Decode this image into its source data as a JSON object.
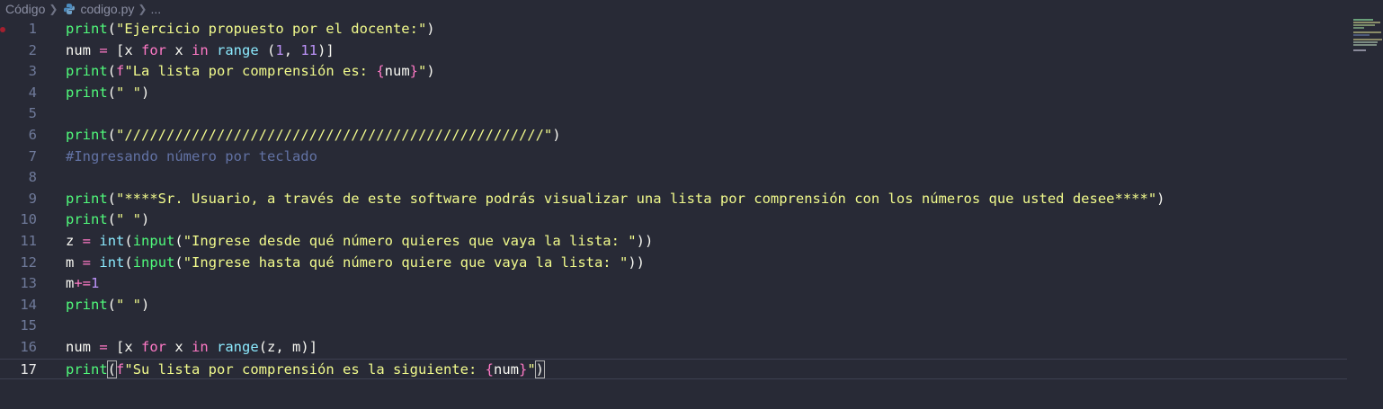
{
  "breadcrumb": {
    "folder": "Código",
    "file": "codigo.py",
    "more": "..."
  },
  "editor": {
    "lines": [
      {
        "n": "1",
        "tokens": [
          [
            "fn",
            "print"
          ],
          [
            "br",
            "("
          ],
          [
            "str",
            "\"Ejercicio propuesto por el docente:\""
          ],
          [
            "br",
            ")"
          ]
        ]
      },
      {
        "n": "2",
        "tokens": [
          [
            "",
            "num "
          ],
          [
            "kw",
            "="
          ],
          [
            "",
            " [x "
          ],
          [
            "kw",
            "for"
          ],
          [
            "",
            " x "
          ],
          [
            "kw",
            "in"
          ],
          [
            "",
            " "
          ],
          [
            "bi",
            "range"
          ],
          [
            "",
            " "
          ],
          [
            "br",
            "("
          ],
          [
            "nm",
            "1"
          ],
          [
            "",
            ", "
          ],
          [
            "nm",
            "11"
          ],
          [
            "br",
            ")"
          ],
          [
            "",
            "]"
          ]
        ]
      },
      {
        "n": "3",
        "tokens": [
          [
            "fn",
            "print"
          ],
          [
            "br",
            "("
          ],
          [
            "kw",
            "f"
          ],
          [
            "str",
            "\"La lista por comprensión es: "
          ],
          [
            "kw",
            "{"
          ],
          [
            "",
            "num"
          ],
          [
            "kw",
            "}"
          ],
          [
            "str",
            "\""
          ],
          [
            "br",
            ")"
          ]
        ]
      },
      {
        "n": "4",
        "tokens": [
          [
            "fn",
            "print"
          ],
          [
            "br",
            "("
          ],
          [
            "str",
            "\" \""
          ],
          [
            "br",
            ")"
          ]
        ]
      },
      {
        "n": "5",
        "tokens": []
      },
      {
        "n": "6",
        "tokens": [
          [
            "fn",
            "print"
          ],
          [
            "br",
            "("
          ],
          [
            "str",
            "\"//////////////////////////////////////////////////\""
          ],
          [
            "br",
            ")"
          ]
        ]
      },
      {
        "n": "7",
        "tokens": [
          [
            "cm",
            "#Ingresando número por teclado"
          ]
        ]
      },
      {
        "n": "8",
        "tokens": []
      },
      {
        "n": "9",
        "tokens": [
          [
            "fn",
            "print"
          ],
          [
            "br",
            "("
          ],
          [
            "str",
            "\"****Sr. Usuario, a través de este software podrás visualizar una lista por comprensión con los números que usted desee****\""
          ],
          [
            "br",
            ")"
          ]
        ]
      },
      {
        "n": "10",
        "tokens": [
          [
            "fn",
            "print"
          ],
          [
            "br",
            "("
          ],
          [
            "str",
            "\" \""
          ],
          [
            "br",
            ")"
          ]
        ]
      },
      {
        "n": "11",
        "tokens": [
          [
            "",
            "z "
          ],
          [
            "kw",
            "="
          ],
          [
            "",
            " "
          ],
          [
            "bi",
            "int"
          ],
          [
            "br",
            "("
          ],
          [
            "fn",
            "input"
          ],
          [
            "br",
            "("
          ],
          [
            "str",
            "\"Ingrese desde qué número quieres que vaya la lista: \""
          ],
          [
            "br",
            "))"
          ]
        ]
      },
      {
        "n": "12",
        "tokens": [
          [
            "",
            "m "
          ],
          [
            "kw",
            "="
          ],
          [
            "",
            " "
          ],
          [
            "bi",
            "int"
          ],
          [
            "br",
            "("
          ],
          [
            "fn",
            "input"
          ],
          [
            "br",
            "("
          ],
          [
            "str",
            "\"Ingrese hasta qué número quiere que vaya la lista: \""
          ],
          [
            "br",
            "))"
          ]
        ]
      },
      {
        "n": "13",
        "tokens": [
          [
            "",
            "m"
          ],
          [
            "kw",
            "+="
          ],
          [
            "nm",
            "1"
          ]
        ]
      },
      {
        "n": "14",
        "tokens": [
          [
            "fn",
            "print"
          ],
          [
            "br",
            "("
          ],
          [
            "str",
            "\" \""
          ],
          [
            "br",
            ")"
          ]
        ]
      },
      {
        "n": "15",
        "tokens": []
      },
      {
        "n": "16",
        "tokens": [
          [
            "",
            "num "
          ],
          [
            "kw",
            "="
          ],
          [
            "",
            " [x "
          ],
          [
            "kw",
            "for"
          ],
          [
            "",
            " x "
          ],
          [
            "kw",
            "in"
          ],
          [
            "",
            " "
          ],
          [
            "bi",
            "range"
          ],
          [
            "br",
            "("
          ],
          [
            "",
            "z, m"
          ],
          [
            "br",
            ")"
          ],
          [
            "",
            "]"
          ]
        ]
      },
      {
        "n": "17",
        "tokens": [
          [
            "fn",
            "print"
          ],
          [
            "bm",
            "("
          ],
          [
            "kw",
            "f"
          ],
          [
            "str",
            "\"Su lista por comprensión es la siguiente: "
          ],
          [
            "kw",
            "{"
          ],
          [
            "",
            "num"
          ],
          [
            "kw",
            "}"
          ],
          [
            "str",
            "\""
          ],
          [
            "bm",
            ")"
          ]
        ]
      }
    ],
    "current_line": "17"
  },
  "colors": {
    "background": "#282a36",
    "function": "#50fa7b",
    "string": "#f1fa8c",
    "keyword": "#ff79c6",
    "builtin": "#8be9fd",
    "number": "#bd93f9",
    "comment": "#6272a4"
  },
  "icons": {
    "python_file": "python-icon",
    "separator": "chevron-right-icon",
    "breakpoint": "breakpoint-dot-icon"
  }
}
